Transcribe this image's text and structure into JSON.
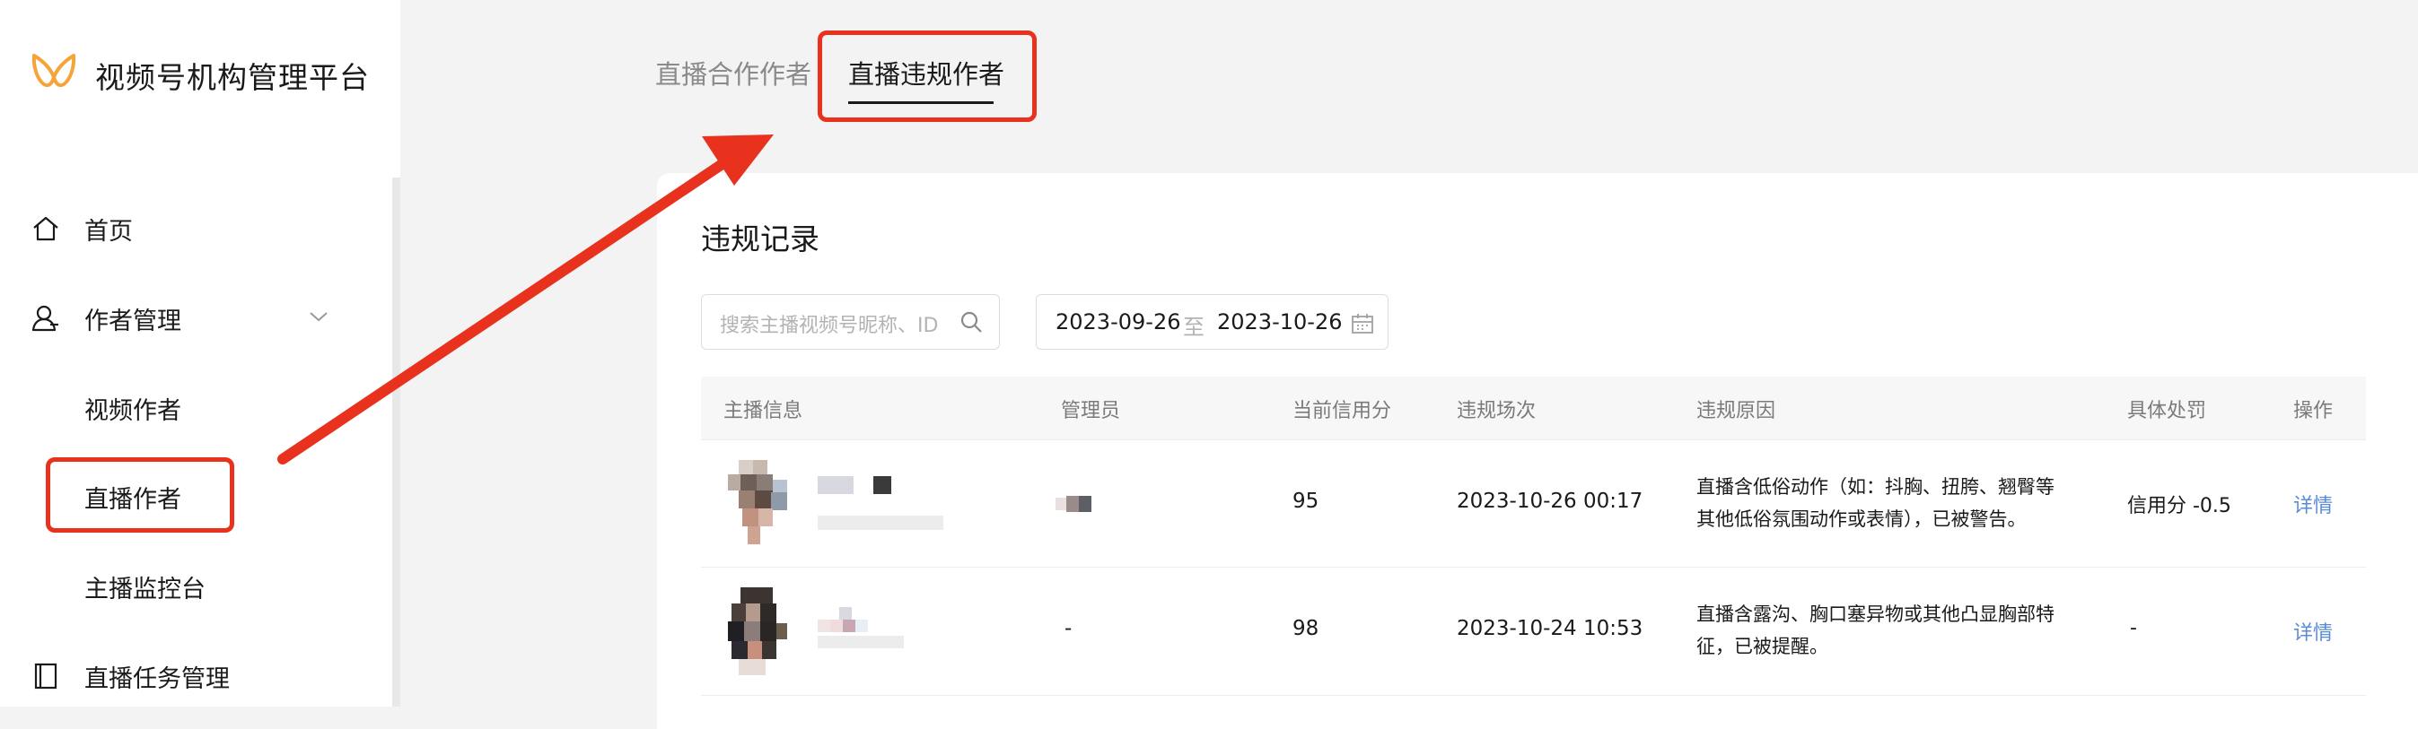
{
  "sidebar": {
    "brand": "视频号机构管理平台",
    "items": [
      {
        "label": "首页"
      },
      {
        "label": "作者管理"
      },
      {
        "label": "视频作者"
      },
      {
        "label": "直播作者"
      },
      {
        "label": "主播监控台"
      },
      {
        "label": "直播任务管理"
      }
    ]
  },
  "tabs": [
    {
      "label": "直播合作作者"
    },
    {
      "label": "直播违规作者"
    }
  ],
  "main": {
    "title": "违规记录",
    "search": {
      "placeholder": "搜索主播视频号昵称、ID"
    },
    "date_range": {
      "start": "2023-09-26",
      "separator": "至",
      "end": "2023-10-26"
    }
  },
  "table": {
    "columns": [
      "主播信息",
      "管理员",
      "当前信用分",
      "违规场次",
      "违规原因",
      "具体处罚",
      "操作"
    ],
    "rows": [
      {
        "admin": "",
        "credit": "95",
        "time": "2023-10-26 00:17",
        "reason_line1": "直播含低俗动作（如：抖胸、扭胯、翘臀等",
        "reason_line2": "其他低俗氛围动作或表情），已被警告。",
        "penalty": "信用分 -0.5",
        "action": "详情"
      },
      {
        "admin": "-",
        "credit": "98",
        "time": "2023-10-24 10:53",
        "reason_line1": "直播含露沟、胸口塞异物或其他凸显胸部特",
        "reason_line2": "征，已被提醒。",
        "penalty": "-",
        "action": "详情"
      }
    ]
  },
  "colors": {
    "highlight": "#e8321e",
    "link": "#5b8bd6",
    "brand_orange": "#f5a43a"
  }
}
